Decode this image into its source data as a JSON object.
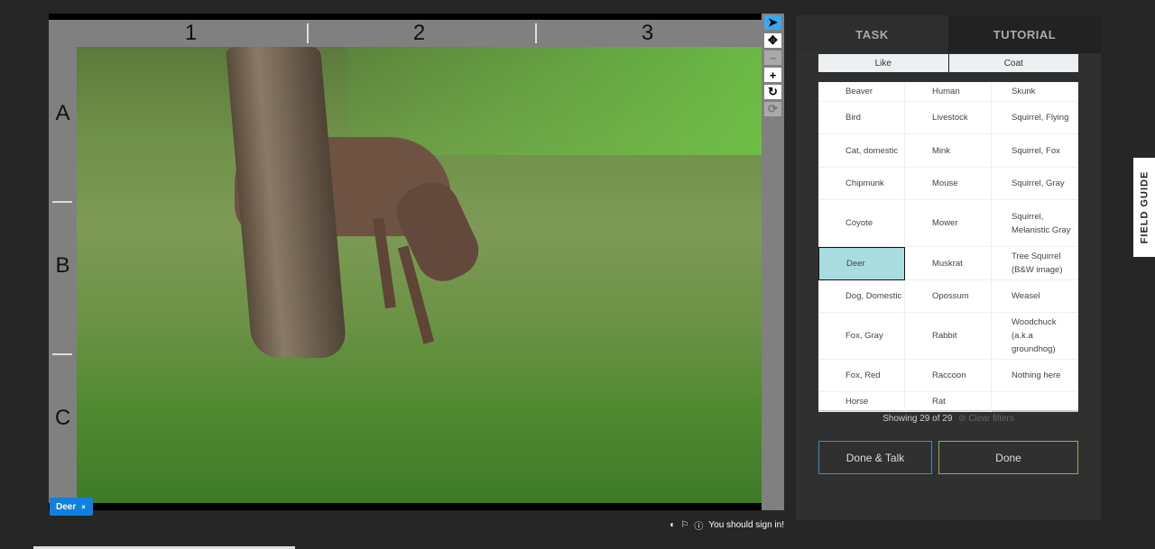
{
  "viewer": {
    "columns": [
      "1",
      "2",
      "3"
    ],
    "rows": [
      "A",
      "B",
      "C"
    ],
    "tools": [
      {
        "name": "pointer",
        "glyph": "➤"
      },
      {
        "name": "move",
        "glyph": "✥"
      },
      {
        "name": "zoom-out",
        "glyph": "−"
      },
      {
        "name": "zoom-in",
        "glyph": "+"
      },
      {
        "name": "rotate",
        "glyph": "↻"
      },
      {
        "name": "reset",
        "glyph": "⟳"
      }
    ]
  },
  "selection_tag": {
    "label": "Deer",
    "remove": "×"
  },
  "footer": {
    "sign_in": "You should sign in!"
  },
  "tabs": {
    "task": "TASK",
    "tutorial": "TUTORIAL"
  },
  "filters": {
    "like": "Like",
    "coat": "Coat"
  },
  "species": [
    [
      "Beaver",
      "Human",
      "Skunk"
    ],
    [
      "Bird",
      "Livestock",
      "Squirrel, Flying"
    ],
    [
      "Cat, domestic",
      "Mink",
      "Squirrel, Fox"
    ],
    [
      "Chipmunk",
      "Mouse",
      "Squirrel, Gray"
    ],
    [
      "Coyote",
      "Mower",
      "Squirrel, Melanistic Gray"
    ],
    [
      "Deer",
      "Muskrat",
      "Tree Squirrel (B&W image)"
    ],
    [
      "Dog, Domestic",
      "Opossum",
      "Weasel"
    ],
    [
      "Fox, Gray",
      "Rabbit",
      "Woodchuck (a.k.a groundhog)"
    ],
    [
      "Fox, Red",
      "Raccoon",
      "Nothing here"
    ],
    [
      "Horse",
      "Rat",
      ""
    ]
  ],
  "selected": "Deer",
  "showing": "Showing 29 of 29",
  "clear_filters": "⊘ Clear filters",
  "buttons": {
    "done_talk": "Done & Talk",
    "done": "Done"
  },
  "field_guide": "FIELD GUIDE",
  "colors": {
    "selected": "#a8dcdf",
    "tag": "#0f7fe0",
    "active_tool": "#3aa8f0"
  }
}
